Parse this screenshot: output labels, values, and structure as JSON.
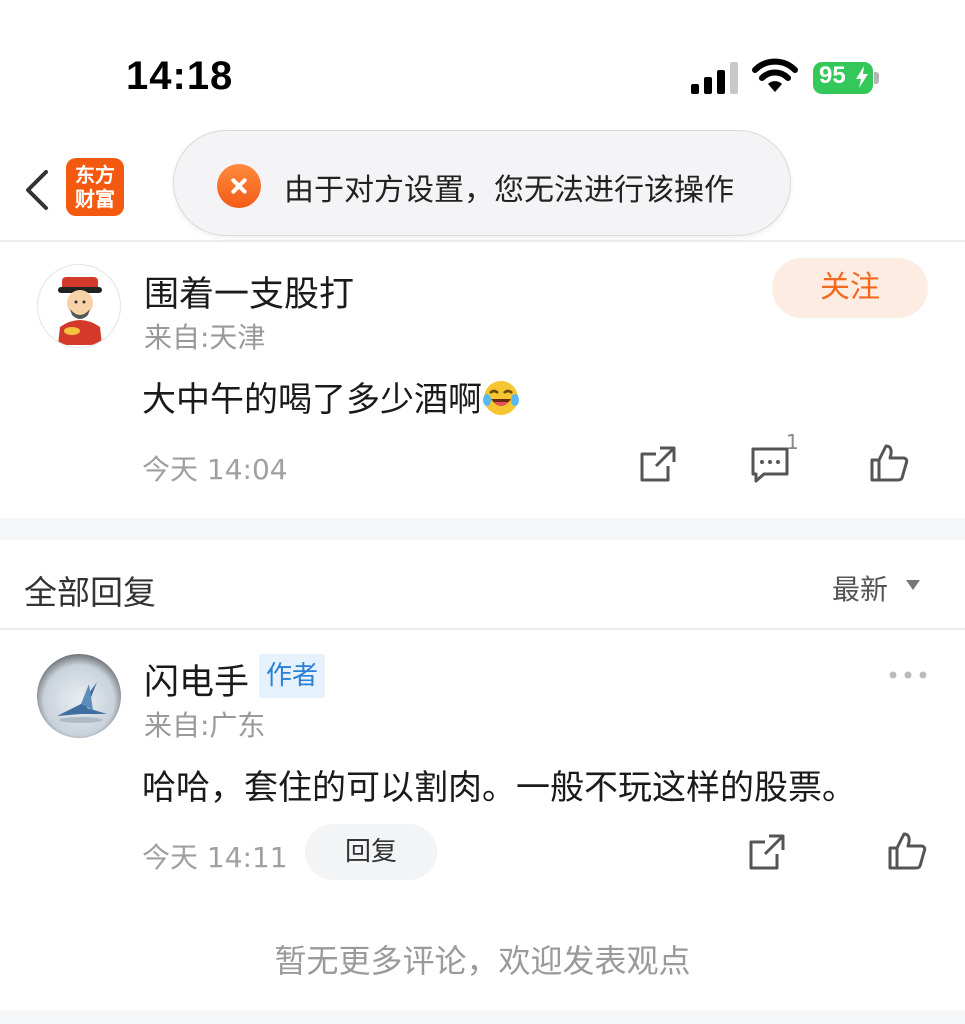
{
  "status_bar": {
    "time": "14:18",
    "battery_level": "95",
    "battery_color": "#34c759",
    "icons": [
      "signal-icon",
      "wifi-icon",
      "battery-icon",
      "charging-bolt-icon"
    ]
  },
  "nav": {
    "back_icon": "chevron-left-icon",
    "logo_line1": "东方",
    "logo_line2": "财富",
    "brand_color": "#f45a0f"
  },
  "toast": {
    "icon": "error-x-icon",
    "message": "由于对方设置，您无法进行该操作"
  },
  "post": {
    "username": "围着一支股打",
    "location": "来自:天津",
    "follow_label": "关注",
    "text": "大中午的喝了多少酒啊",
    "emoji": "laughing-crying-emoji",
    "time": "今天 14:04",
    "comment_count": "1",
    "icons": [
      "share-icon",
      "comment-icon",
      "like-icon"
    ]
  },
  "replies": {
    "title": "全部回复",
    "sort_label": "最新",
    "items": [
      {
        "username": "闪电手",
        "badge": "作者",
        "location": "来自:广东",
        "text": "哈哈，套住的可以割肉。一般不玩这样的股票。",
        "time": "今天 14:11",
        "reply_label": "回复"
      }
    ]
  },
  "footer": {
    "no_more_text": "暂无更多评论，欢迎发表观点"
  }
}
